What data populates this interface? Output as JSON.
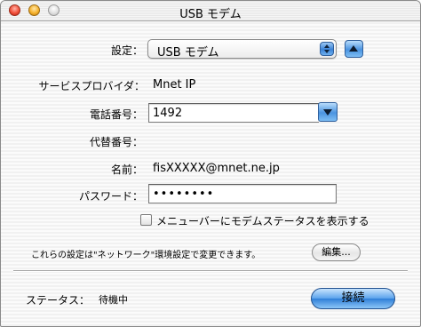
{
  "window": {
    "title": "USB モデム"
  },
  "settings": {
    "label": "設定：",
    "selected": "USB モデム"
  },
  "provider": {
    "label": "サービスプロバイダ：",
    "value": "Mnet IP"
  },
  "phone": {
    "label": "電話番号：",
    "value": "1492"
  },
  "alt_phone": {
    "label": "代替番号："
  },
  "name": {
    "label": "名前：",
    "value": "fisXXXXX@mnet.ne.jp"
  },
  "password": {
    "label": "パスワード：",
    "value": "••••••••"
  },
  "menubar_checkbox": {
    "label": "メニューバーにモデムステータスを表示する",
    "checked": false
  },
  "note": {
    "text": "これらの設定は\"ネットワーク\"環境設定で変更できます。"
  },
  "edit_button": {
    "label": "編集..."
  },
  "status": {
    "label": "ステータス：",
    "value": "待機中"
  },
  "connect_button": {
    "label": "接続"
  }
}
